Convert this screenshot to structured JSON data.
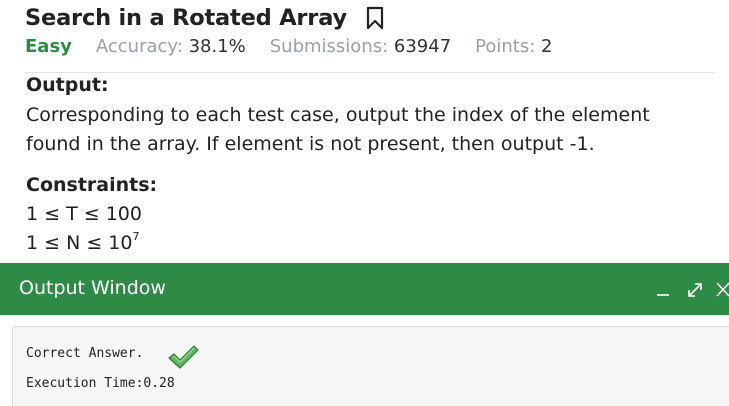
{
  "problem": {
    "title": "Search in a Rotated Array",
    "difficulty": "Easy",
    "accuracy_label": "Accuracy:",
    "accuracy_value": "38.1%",
    "submissions_label": "Submissions:",
    "submissions_value": "63947",
    "points_label": "Points:",
    "points_value": "2"
  },
  "output_section": {
    "title": "Output:",
    "text_line1": "Corresponding to each test case, output the index of the element",
    "text_line2": "found in the array.  If element is not present, then output -1."
  },
  "constraints": {
    "title": "Constraints:",
    "line1": "1 ≤ T ≤ 100",
    "line2_base": "1 ≤ N ≤ 10",
    "line2_exp": "7"
  },
  "output_window": {
    "title": "Output Window",
    "result": "Correct Answer.",
    "execution_time": "Execution Time:0.28"
  },
  "colors": {
    "accent_green": "#2e8b46",
    "check_green": "#5cb85c"
  },
  "icons": {
    "bookmark": "bookmark-icon",
    "minimize": "minimize-icon",
    "expand": "expand-icon",
    "close": "close-icon",
    "check": "checkmark-icon"
  }
}
